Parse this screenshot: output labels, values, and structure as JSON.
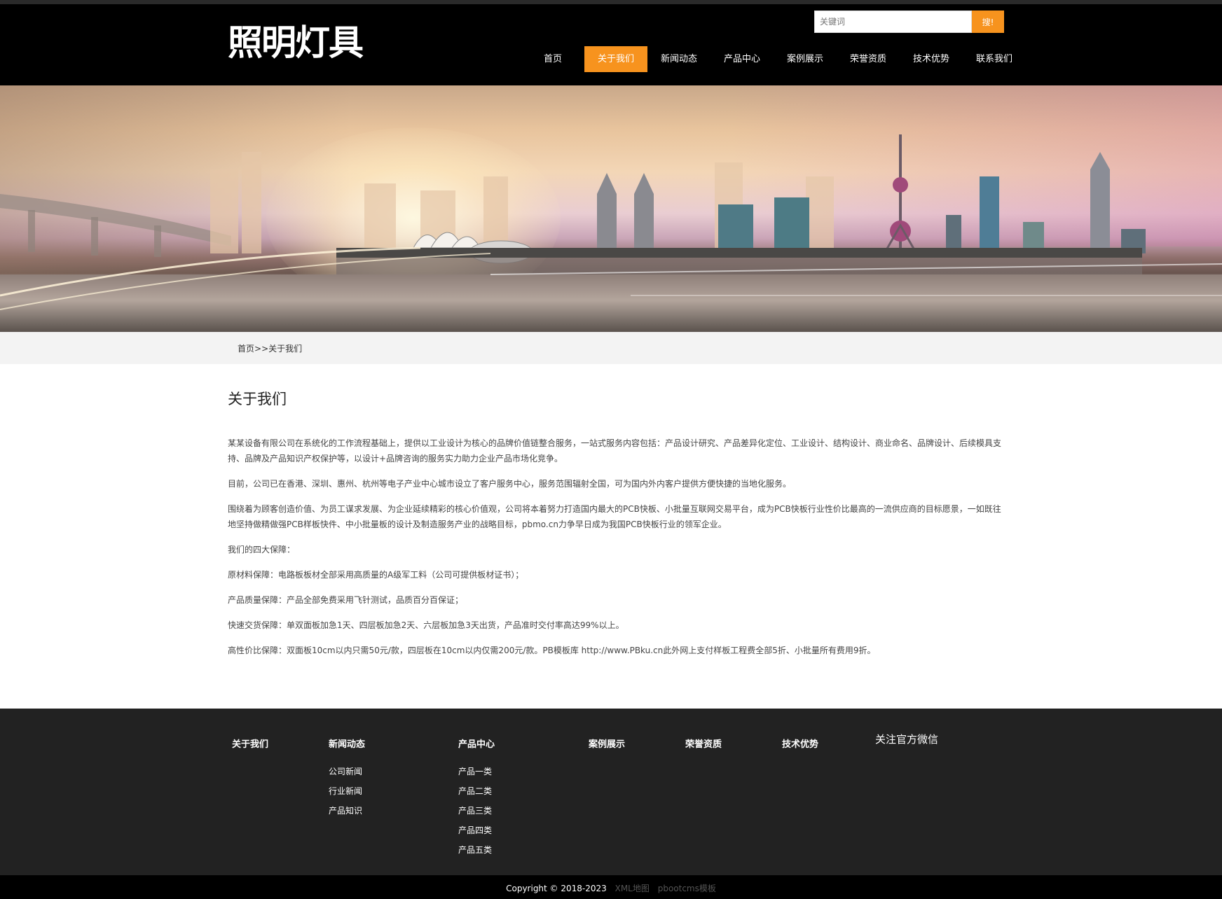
{
  "header": {
    "logo": "照明灯具",
    "search": {
      "placeholder": "关键词",
      "button": "搜!"
    },
    "nav": [
      {
        "label": "首页"
      },
      {
        "label": "关于我们",
        "active": true
      },
      {
        "label": "新闻动态"
      },
      {
        "label": "产品中心"
      },
      {
        "label": "案例展示"
      },
      {
        "label": "荣誉资质"
      },
      {
        "label": "技术优势"
      },
      {
        "label": "联系我们"
      }
    ],
    "accent_color": "#f7931e"
  },
  "breadcrumb": {
    "home": "首页",
    "separator": ">>",
    "current": "关于我们"
  },
  "content": {
    "title": "关于我们",
    "paragraphs": [
      "某某设备有限公司在系统化的工作流程基础上，提供以工业设计为核心的品牌价值链整合服务，一站式服务内容包括：产品设计研究、产品差异化定位、工业设计、结构设计、商业命名、品牌设计、后续模具支持、品牌及产品知识产权保护等，以设计+品牌咨询的服务实力助力企业产品市场化竞争。",
      "目前，公司已在香港、深圳、惠州、杭州等电子产业中心城市设立了客户服务中心，服务范围辐射全国，可为国内外内客户提供方便快捷的当地化服务。",
      "围绕着为顾客创造价值、为员工谋求发展、为企业延续精彩的核心价值观，公司将本着努力打造国内最大的PCB快板、小批量互联网交易平台，成为PCB快板行业性价比最高的一流供应商的目标愿景，一如既往地坚持做精做强PCB样板快件、中小批量板的设计及制造服务产业的战略目标，pbmo.cn力争早日成为我国PCB快板行业的领军企业。",
      "我们的四大保障：",
      "原材料保障：电路板板材全部采用高质量的A级军工料（公司可提供板材证书）；",
      "产品质量保障：产品全部免费采用飞针测试，品质百分百保证；",
      "快速交货保障：单双面板加急1天、四层板加急2天、六层板加急3天出货，产品准时交付率高达99%以上。",
      "高性价比保障：双面板10cm以内只需50元/款，四层板在10cm以内仅需200元/款。PB模板库 http://www.PBku.cn此外网上支付样板工程费全部5折、小批量所有费用9折。"
    ]
  },
  "footer": {
    "columns": [
      {
        "title": "关于我们",
        "links": []
      },
      {
        "title": "新闻动态",
        "links": [
          "公司新闻",
          "行业新闻",
          "产品知识"
        ]
      },
      {
        "title": "产品中心",
        "links": [
          "产品一类",
          "产品二类",
          "产品三类",
          "产品四类",
          "产品五类"
        ]
      },
      {
        "title": "案例展示",
        "links": []
      },
      {
        "title": "荣誉资质",
        "links": []
      },
      {
        "title": "技术优势",
        "links": []
      }
    ],
    "wechat_title": "关注官方微信",
    "copyright": "Copyright © 2018-2023",
    "sitemap": "XML地图",
    "template_link": "pbootcms模板"
  }
}
